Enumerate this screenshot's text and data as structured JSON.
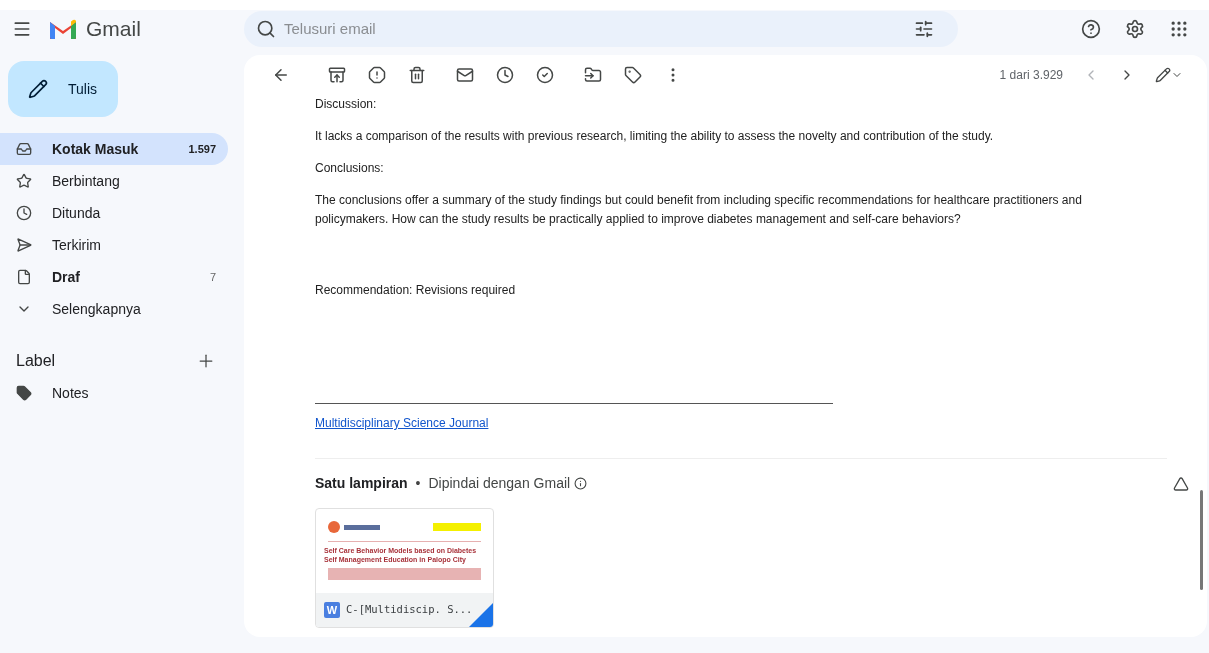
{
  "app": {
    "name": "Gmail"
  },
  "search": {
    "placeholder": "Telusuri email"
  },
  "compose": {
    "label": "Tulis"
  },
  "sidebar": {
    "items": [
      {
        "label": "Kotak Masuk",
        "count": "1.597",
        "selected": true,
        "bold": true
      },
      {
        "label": "Berbintang",
        "selected": false,
        "bold": false
      },
      {
        "label": "Ditunda",
        "selected": false,
        "bold": false
      },
      {
        "label": "Terkirim",
        "selected": false,
        "bold": false
      },
      {
        "label": "Draf",
        "count": "7",
        "selected": false,
        "bold": true
      },
      {
        "label": "Selengkapnya",
        "selected": false,
        "bold": false
      }
    ],
    "labels_heading": "Label",
    "labels": [
      {
        "label": "Notes"
      }
    ]
  },
  "toolbar": {
    "pager": "1 dari 3.929"
  },
  "message": {
    "paragraphs": [
      {
        "kind": "heading",
        "text": "Discussion:"
      },
      {
        "kind": "text",
        "text": "It lacks a comparison of the results with previous research, limiting the ability to assess the novelty and contribution of the study."
      },
      {
        "kind": "heading",
        "text": "Conclusions:"
      },
      {
        "kind": "text",
        "text": "The conclusions offer a summary of the study findings but could benefit from including specific recommendations for healthcare practitioners and policymakers. How can the study results be practically applied to improve diabetes management and self-care behaviors?"
      },
      {
        "kind": "gap",
        "text": "Recommendation: Revisions required"
      }
    ],
    "signature_link": "Multidisciplinary Science Journal"
  },
  "attachments": {
    "title": "Satu lampiran",
    "separator": "•",
    "scan_note": "Dipindai dengan Gmail",
    "files": [
      {
        "name": "C-[Multidiscip. S...",
        "type_letter": "W",
        "doc_title": "Self Care Behavior Models based on Diabetes Self Management Education in Palopo City"
      }
    ]
  }
}
